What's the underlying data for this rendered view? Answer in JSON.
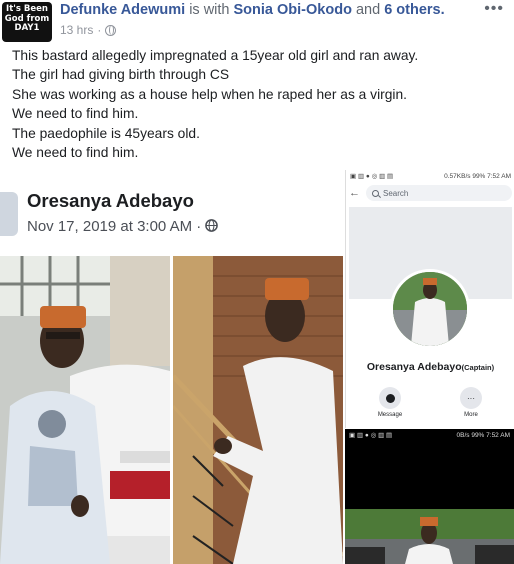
{
  "post": {
    "avatar_text": "It's Been God from DAY1",
    "author": "Defunke Adewumi",
    "is_with_prefix": "is with",
    "tagged": "Sonia Obi-Okodo",
    "and_text": "and",
    "others": "6 others.",
    "time": "13 hrs",
    "time_sep": "·",
    "menu_icon": "more-dots-icon",
    "lines": [
      "This bastard allegedly impregnated a 15year old girl and ran away.",
      "The girl had giving birth through CS",
      "She was working as a house help when he raped her as a virgin.",
      "We need to find him.",
      "The paedophile is 45years old.",
      "We need to find him."
    ]
  },
  "left_screenshot": {
    "name": "Oresanya Adebayo",
    "date": "Nov 17, 2019 at 3:00 AM",
    "date_sep": "·"
  },
  "phone_a": {
    "status_right": "0.57KB/s  99% 7:52 AM",
    "search_placeholder": "Search",
    "profile_name": "Oresanya Adebayo",
    "profile_suffix": "(Captain)",
    "action_message": "Message",
    "action_more": "More"
  },
  "phone_b": {
    "status_right": "0B/s  99% 7:52 AM"
  },
  "colors": {
    "link": "#385898",
    "muted": "#90949c",
    "text": "#1c1e21"
  }
}
